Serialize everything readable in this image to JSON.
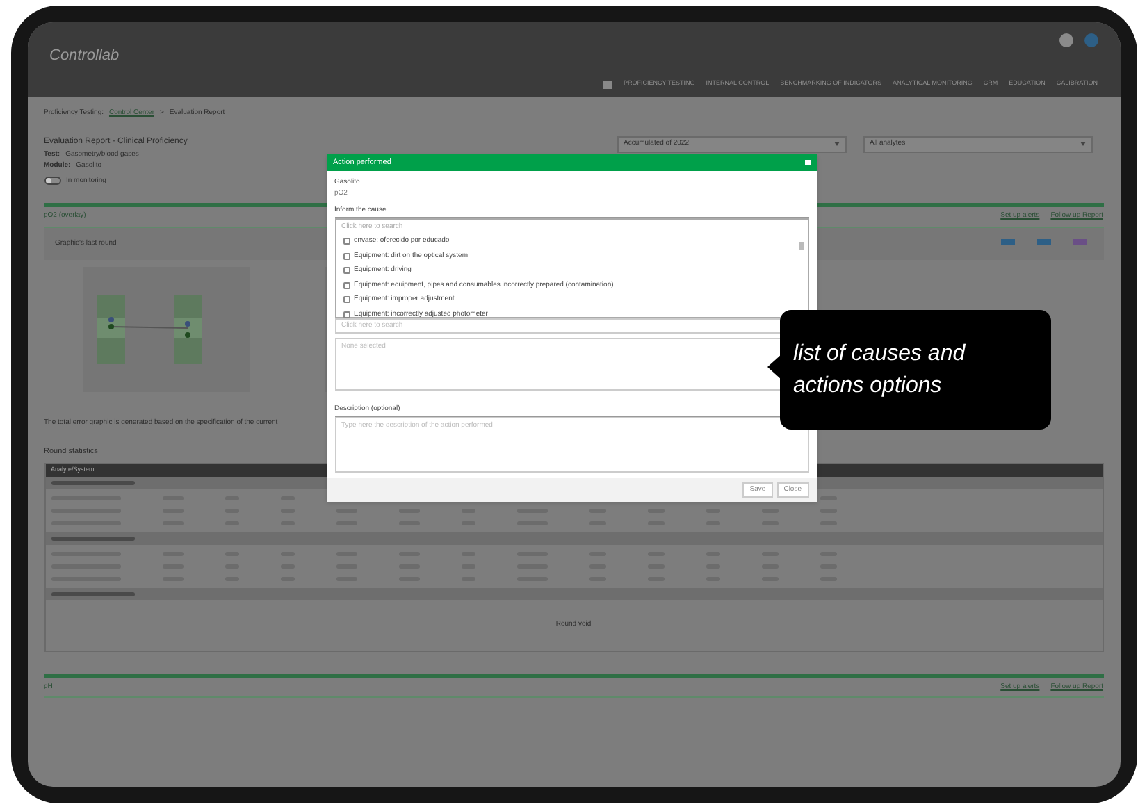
{
  "header": {
    "logo": "Controllab",
    "nav": [
      "PROFICIENCY TESTING",
      "INTERNAL CONTROL",
      "BENCHMARKING OF INDICATORS",
      "ANALYTICAL MONITORING",
      "CRM",
      "EDUCATION",
      "CALIBRATION"
    ]
  },
  "breadcrumb": [
    {
      "label": "Proficiency Testing:",
      "link": false
    },
    {
      "label": "Control Center",
      "link": true
    },
    {
      "label": ">",
      "link": false
    },
    {
      "label": "Evaluation Report",
      "link": false
    }
  ],
  "report": {
    "title": "Evaluation Report - Clinical Proficiency",
    "test_label": "Test:",
    "test": "Gasometry/blood gases",
    "module_label": "Module:",
    "module": "Gasolito",
    "toggle": {
      "label": "In monitoring",
      "on": false
    }
  },
  "filters": [
    "Accumulated of 2022",
    "All analytes"
  ],
  "section": {
    "title": "pO2 (overlay)",
    "links": [
      "Set up alerts",
      "Follow up Report"
    ],
    "graphic_label": "Graphic's last round"
  },
  "note": "The total error graphic is generated based on the specification of the current",
  "statistics_title": "Round statistics",
  "table": {
    "first_column": "Analyte/System",
    "void_text": "Round void"
  },
  "footer_section": {
    "title": "pH",
    "links": [
      "Set up alerts",
      "Follow up Report"
    ]
  },
  "dialog": {
    "title": "Action performed",
    "analyte_label": "Gasolito",
    "analyte": "pO2",
    "causes_label": "Inform the cause",
    "search_placeholder": "Click here to search",
    "causes": [
      {
        "label": "envase: oferecido por educado",
        "checked": false
      },
      {
        "label": "Equipment: dirt on the optical system",
        "checked": false
      },
      {
        "label": "Equipment: driving",
        "checked": false
      },
      {
        "label": "Equipment: equipment, pipes and consumables incorrectly prepared (contamination)",
        "checked": false
      },
      {
        "label": "Equipment: improper adjustment",
        "checked": false
      },
      {
        "label": "Equipment: incorrectly adjusted photometer",
        "checked": false
      }
    ],
    "search2_placeholder": "Click here to search",
    "selected_placeholder": "None selected",
    "description_label": "Description (optional)",
    "description_placeholder": "Type here the description of the action performed",
    "buttons": [
      "Save",
      "Close"
    ]
  },
  "callout": [
    "list of causes and",
    "actions options"
  ]
}
